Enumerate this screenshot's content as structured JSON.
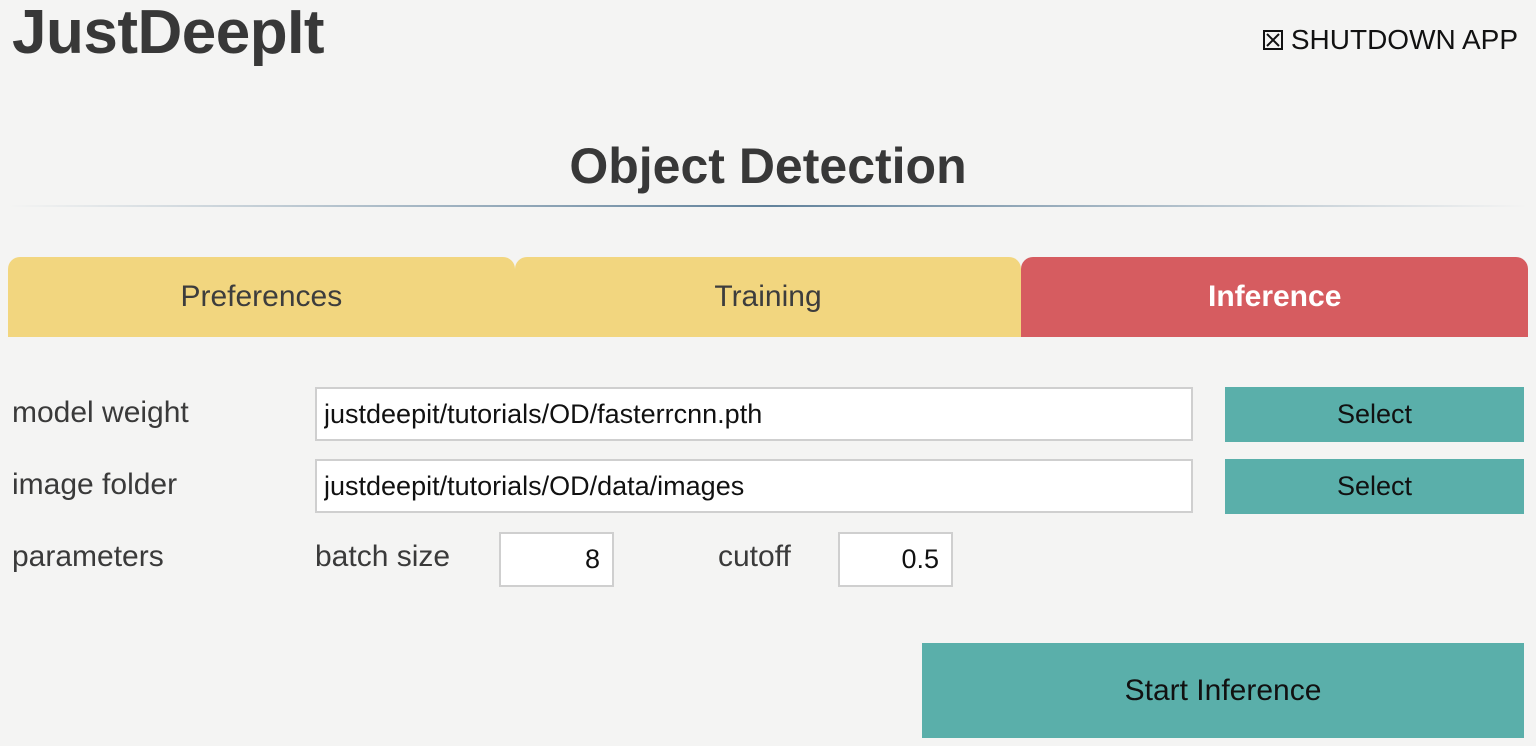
{
  "app": {
    "title": "JustDeepIt",
    "shutdown_label": "SHUTDOWN APP",
    "shutdown_icon": "checkbox-x-icon"
  },
  "page": {
    "title": "Object Detection"
  },
  "tabs": [
    {
      "label": "Preferences",
      "active": false
    },
    {
      "label": "Training",
      "active": false
    },
    {
      "label": "Inference",
      "active": true
    }
  ],
  "form": {
    "model_weight": {
      "label": "model weight",
      "value": "justdeepit/tutorials/OD/fasterrcnn.pth",
      "button": "Select"
    },
    "image_folder": {
      "label": "image folder",
      "value": "justdeepit/tutorials/OD/data/images",
      "button": "Select"
    },
    "parameters": {
      "label": "parameters",
      "batch_size_label": "batch size",
      "batch_size_value": "8",
      "cutoff_label": "cutoff",
      "cutoff_value": "0.5"
    }
  },
  "actions": {
    "start_label": "Start Inference"
  },
  "colors": {
    "background": "#f4f4f3",
    "tab_inactive": "#f2d67f",
    "tab_active": "#d65c60",
    "button_teal": "#5aafaa"
  }
}
